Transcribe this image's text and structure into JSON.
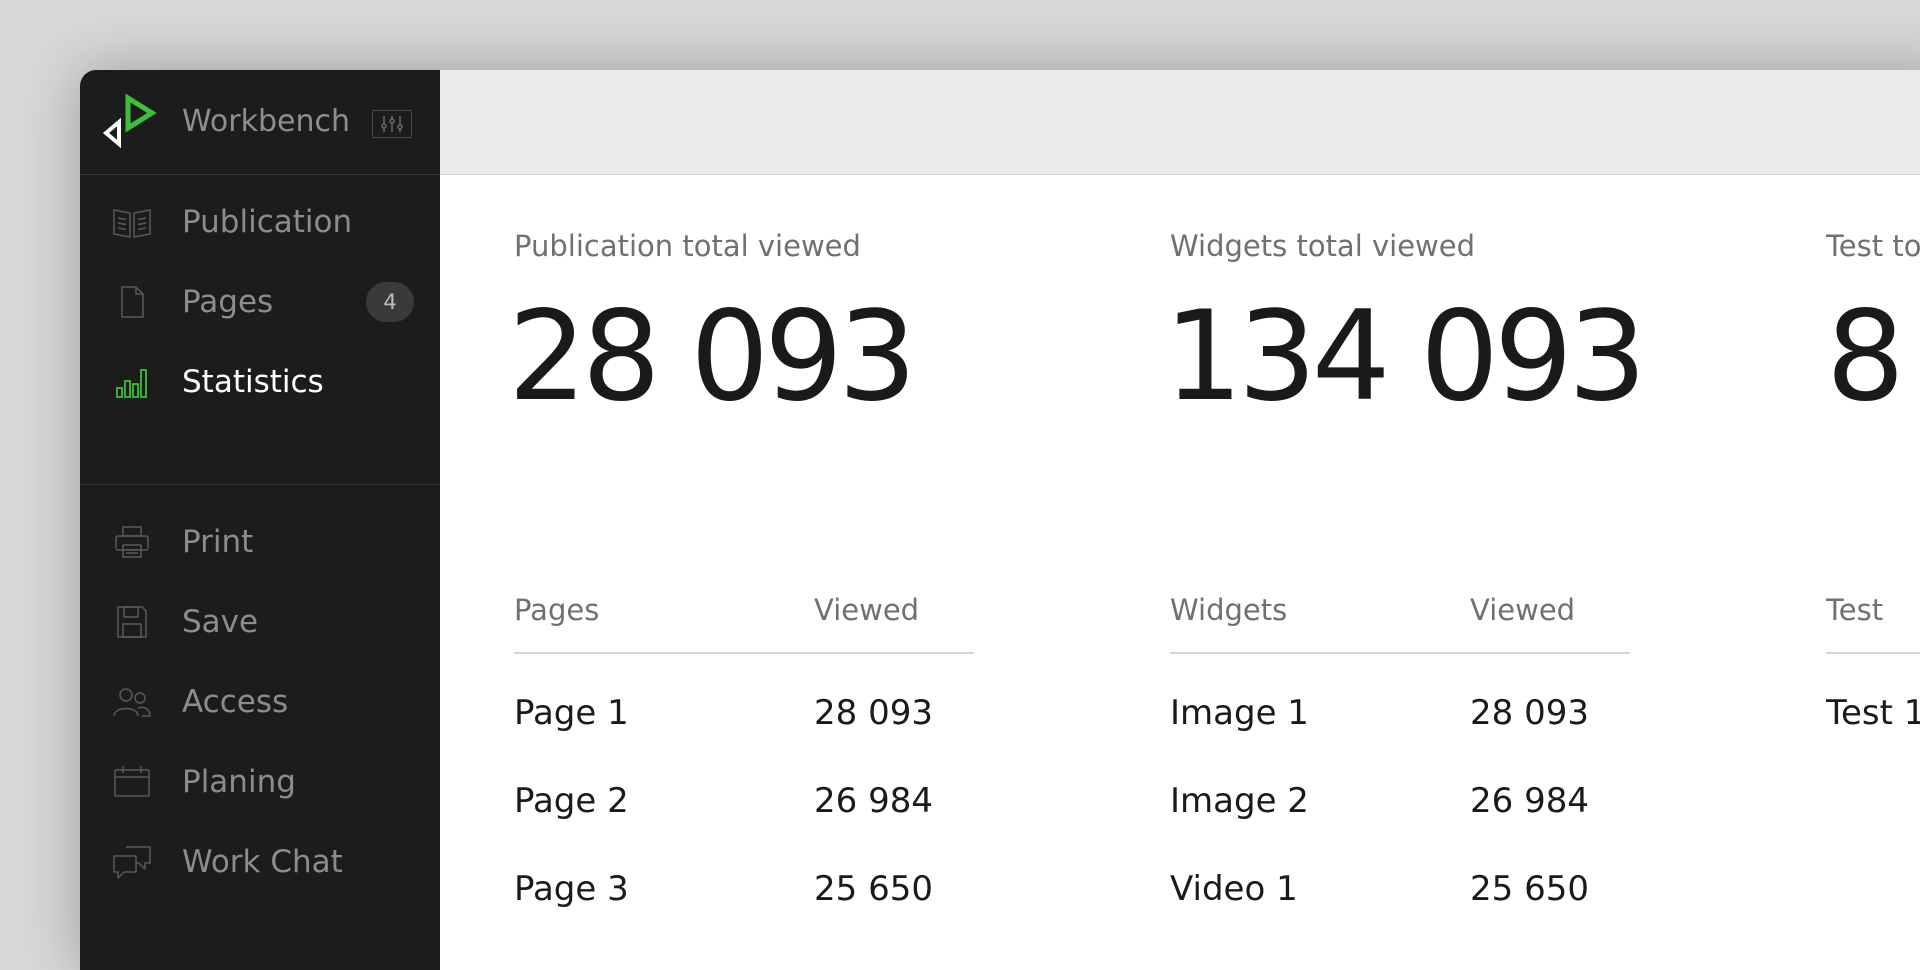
{
  "app": {
    "name": "Workbench",
    "accent_color": "#3cbf3c",
    "logo_icon": "workbench-play-logo",
    "settings_icon": "sliders-icon"
  },
  "sidebar": {
    "primary": [
      {
        "label": "Publication",
        "icon": "book-icon",
        "active": false
      },
      {
        "label": "Pages",
        "icon": "page-icon",
        "badge": "4",
        "active": false
      },
      {
        "label": "Statistics",
        "icon": "bar-chart-icon",
        "active": true
      }
    ],
    "secondary": [
      {
        "label": "Print",
        "icon": "printer-icon"
      },
      {
        "label": "Save",
        "icon": "save-icon"
      },
      {
        "label": "Access",
        "icon": "users-icon"
      },
      {
        "label": "Planing",
        "icon": "calendar-icon"
      },
      {
        "label": "Work Chat",
        "icon": "chat-icon"
      }
    ]
  },
  "stats": [
    {
      "label": "Publication total viewed",
      "value": "28 093",
      "table": {
        "headers": [
          "Pages",
          "Viewed"
        ],
        "rows": [
          [
            "Page 1",
            "28 093"
          ],
          [
            "Page 2",
            "26 984"
          ],
          [
            "Page 3",
            "25 650"
          ]
        ]
      }
    },
    {
      "label": "Widgets total viewed",
      "value": "134 093",
      "table": {
        "headers": [
          "Widgets",
          "Viewed"
        ],
        "rows": [
          [
            "Image 1",
            "28 093"
          ],
          [
            "Image 2",
            "26 984"
          ],
          [
            "Video 1",
            "25 650"
          ]
        ]
      }
    },
    {
      "label": "Test to",
      "value": "8",
      "table": {
        "headers": [
          "Test",
          ""
        ],
        "rows": [
          [
            "Test 1",
            ""
          ]
        ]
      }
    }
  ]
}
